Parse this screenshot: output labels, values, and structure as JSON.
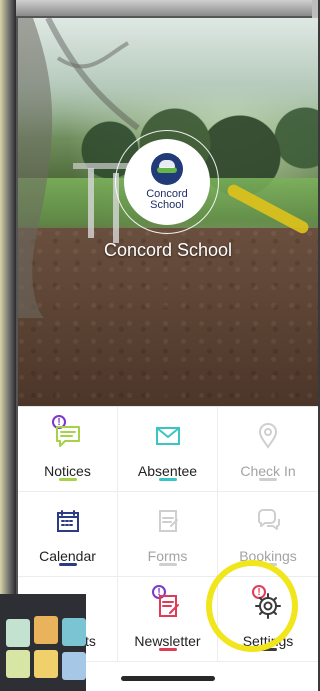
{
  "school": {
    "name": "Concord School",
    "logo_text_top": "Concord",
    "logo_text_bottom": "School"
  },
  "tiles": [
    {
      "key": "notices",
      "label": "Notices",
      "icon": "notice-speech-icon",
      "has_badge": true,
      "badge": "!",
      "badge_color": "#7b38c9",
      "underline_color": "#a6d24a",
      "disabled": false
    },
    {
      "key": "absentee",
      "label": "Absentee",
      "icon": "envelope-icon",
      "has_badge": false,
      "underline_color": "#38c6c3",
      "disabled": false
    },
    {
      "key": "check_in",
      "label": "Check In",
      "icon": "location-pin-icon",
      "has_badge": false,
      "underline_color": "#cfcfcf",
      "disabled": true
    },
    {
      "key": "calendar",
      "label": "Calendar",
      "icon": "calendar-icon",
      "has_badge": false,
      "underline_color": "#2b3b86",
      "disabled": false
    },
    {
      "key": "forms",
      "label": "Forms",
      "icon": "form-edit-icon",
      "has_badge": false,
      "underline_color": "#cfcfcf",
      "disabled": true
    },
    {
      "key": "bookings",
      "label": "Bookings",
      "icon": "chat-bubbles-icon",
      "has_badge": false,
      "underline_color": "#cfcfcf",
      "disabled": true
    },
    {
      "key": "partial",
      "label": "ts",
      "icon": "partial-icon",
      "has_badge": false,
      "underline_color": "#cfcfcf",
      "disabled": false
    },
    {
      "key": "newsletter",
      "label": "Newsletter",
      "icon": "newsletter-edit-icon",
      "has_badge": true,
      "badge": "!",
      "badge_color": "#7b38c9",
      "underline_color": "#e23b57",
      "disabled": false
    },
    {
      "key": "settings",
      "label": "Settings",
      "icon": "gear-icon",
      "has_badge": true,
      "badge": "!",
      "badge_color": "#e23b57",
      "underline_color": "#3a3a3a",
      "disabled": false
    }
  ],
  "colors": {
    "highlight": "#f1e51b",
    "disabled_text": "#a3a3a3"
  }
}
